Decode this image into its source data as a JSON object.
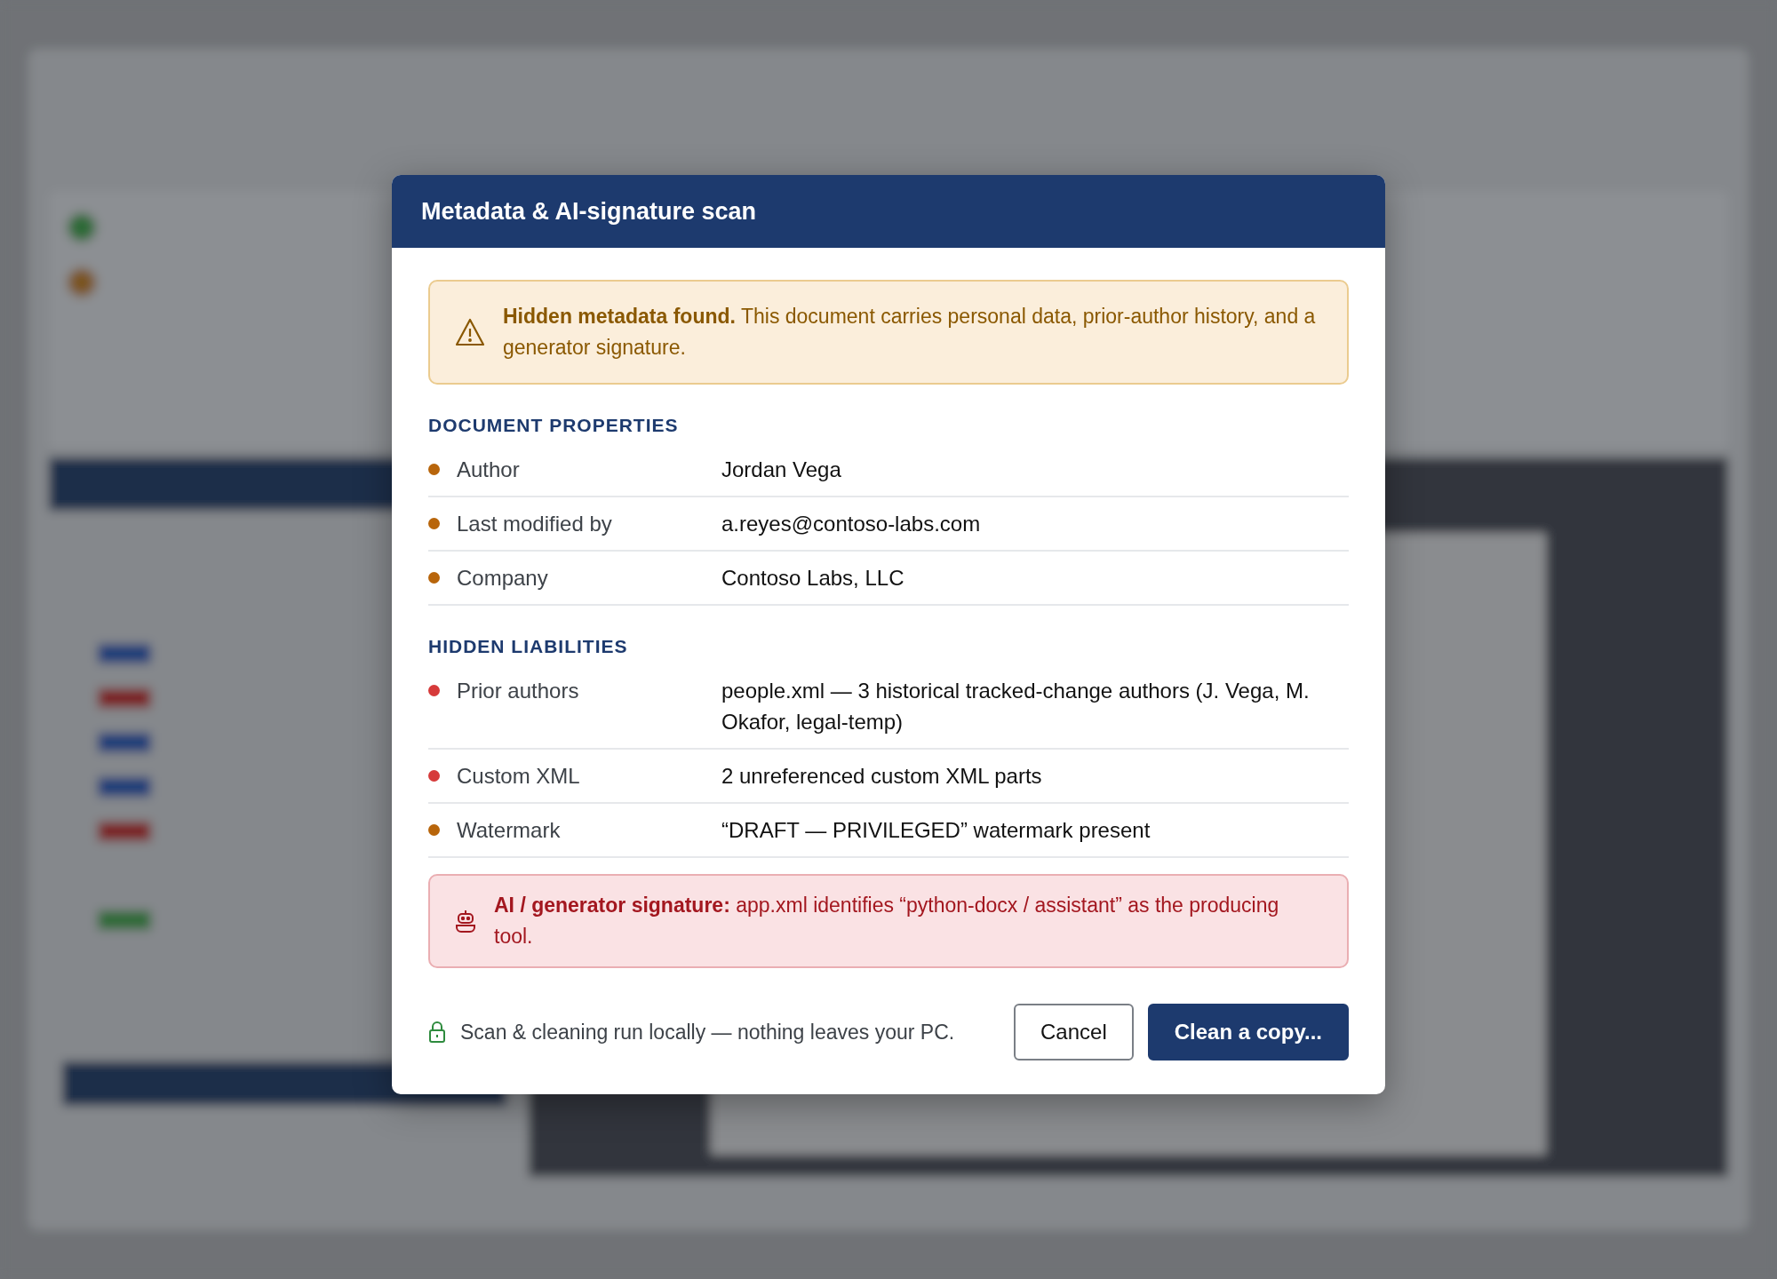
{
  "dialog": {
    "title": "Metadata & AI-signature scan",
    "warning": {
      "text": "**Hidden metadata found.** This document carries personal data, prior-author history, and a generator signature."
    },
    "sections": [
      {
        "heading": "DOCUMENT PROPERTIES",
        "rows": [
          {
            "label": "Author",
            "value": "Jordan Vega",
            "color": "#b8650b"
          },
          {
            "label": "Last modified by",
            "value": "a.reyes@contoso-labs.com",
            "color": "#b8650b"
          },
          {
            "label": "Company",
            "value": "Contoso Labs, LLC",
            "color": "#b8650b"
          }
        ]
      },
      {
        "heading": "HIDDEN LIABILITIES",
        "rows": [
          {
            "label": "Prior authors",
            "value": "people.xml — 3 historical tracked-change authors (J. Vega, M. Okafor, legal-temp)",
            "color": "#d63a3a"
          },
          {
            "label": "Custom XML",
            "value": "2 unreferenced custom XML parts",
            "color": "#d63a3a"
          },
          {
            "label": "Watermark",
            "value": "“DRAFT — PRIVILEGED” watermark present",
            "color": "#b8650b"
          }
        ]
      }
    ],
    "signature": {
      "text": "**AI / generator signature:** app.xml identifies “python-docx / assistant” as the producing tool."
    },
    "footer_note": "Scan & cleaning run locally — nothing leaves your PC.",
    "buttons": [
      {
        "label": "Cancel",
        "kind": "secondary"
      },
      {
        "label": "Clean a copy...",
        "kind": "primary"
      }
    ]
  }
}
